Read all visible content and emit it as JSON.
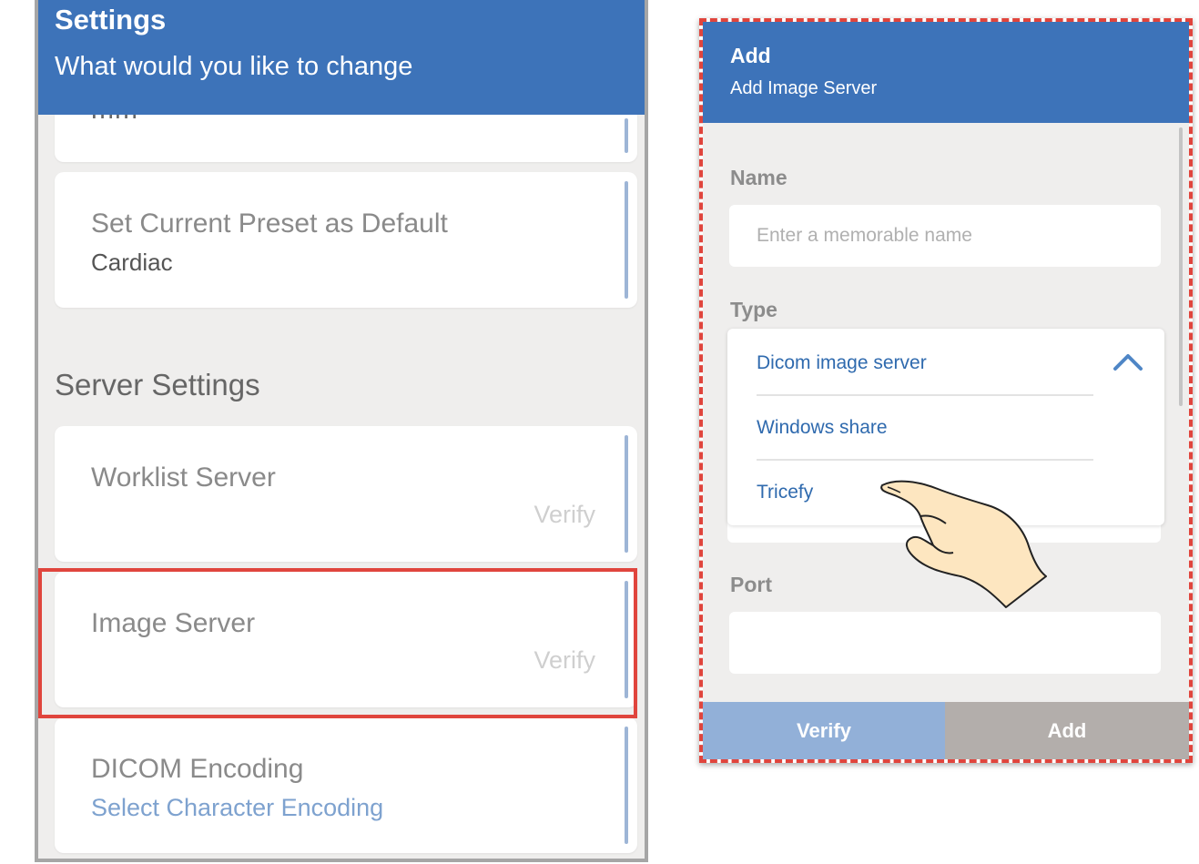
{
  "settings": {
    "title": "Settings",
    "subtitle": "What would you like to change",
    "cut_item_text": "mm",
    "preset_item": {
      "label": "Set Current Preset as Default",
      "value": "Cardiac"
    },
    "server_section_heading": "Server Settings",
    "worklist_item": {
      "label": "Worklist Server",
      "action": "Verify"
    },
    "image_item": {
      "label": "Image Server",
      "action": "Verify"
    },
    "dicom_item": {
      "label": "DICOM Encoding",
      "link": "Select Character Encoding"
    }
  },
  "dialog": {
    "title": "Add",
    "subtitle": "Add Image Server",
    "name_label": "Name",
    "name_placeholder": "Enter a memorable name",
    "type_label": "Type",
    "type_options": [
      "Dicom image server",
      "Windows share",
      "Tricefy"
    ],
    "port_label": "Port",
    "port_value": "",
    "verify_button": "Verify",
    "add_button": "Add"
  },
  "colors": {
    "header_blue": "#3d73b9",
    "highlight_red": "#e0453d",
    "option_blue": "#2f6aae",
    "verify_button_bg": "#92b0d8",
    "add_button_bg": "#b3aeab"
  },
  "icons": {
    "dropdown_toggle": "chevron-up-icon",
    "pointer": "pointing-hand-icon"
  }
}
